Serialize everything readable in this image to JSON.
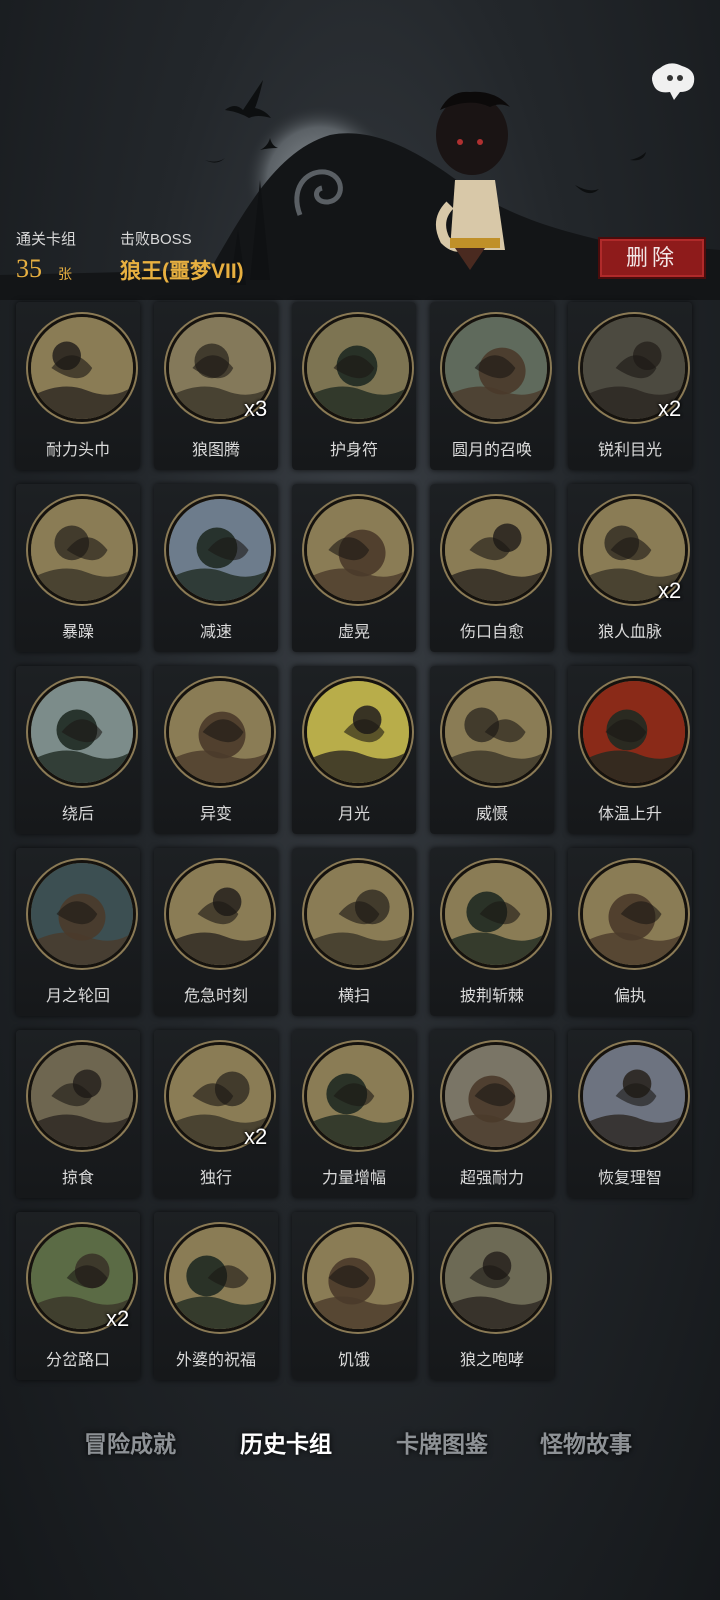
{
  "header": {
    "deck_label": "通关卡组",
    "deck_count": "35",
    "deck_unit": "张",
    "boss_label": "击败BOSS",
    "boss_name": "狼王(噩梦VII)",
    "delete_label": "删除"
  },
  "cards": [
    {
      "name": "耐力头巾",
      "qty": "",
      "icon": "bandana-icon",
      "bg": "#8a7c55"
    },
    {
      "name": "狼图腾",
      "qty": "x3",
      "icon": "wolf-totem-icon",
      "bg": "#84795a"
    },
    {
      "name": "护身符",
      "qty": "",
      "icon": "amulet-icon",
      "bg": "#7d7452"
    },
    {
      "name": "圆月的召唤",
      "qty": "",
      "icon": "full-moon-forest-icon",
      "bg": "#5f6a5c"
    },
    {
      "name": "锐利目光",
      "qty": "x2",
      "icon": "wolf-eyes-icon",
      "bg": "#4c4a40"
    },
    {
      "name": "暴躁",
      "qty": "",
      "icon": "rage-brute-icon",
      "bg": "#8a7c55"
    },
    {
      "name": "减速",
      "qty": "",
      "icon": "clock-slow-icon",
      "bg": "#6d7c8c"
    },
    {
      "name": "虚晃",
      "qty": "",
      "icon": "boxer-icon",
      "bg": "#8a7c55"
    },
    {
      "name": "伤口自愈",
      "qty": "",
      "icon": "healing-boy-icon",
      "bg": "#8a7c55"
    },
    {
      "name": "狼人血脉",
      "qty": "x2",
      "icon": "claw-hand-icon",
      "bg": "#8a7c55"
    },
    {
      "name": "绕后",
      "qty": "",
      "icon": "skull-monster-icon",
      "bg": "#7c8c8a"
    },
    {
      "name": "异变",
      "qty": "",
      "icon": "mutation-icon",
      "bg": "#8a7c55"
    },
    {
      "name": "月光",
      "qty": "",
      "icon": "moonlight-icon",
      "bg": "#b8ad4a"
    },
    {
      "name": "威慑",
      "qty": "",
      "icon": "intimidate-icon",
      "bg": "#8a7c55"
    },
    {
      "name": "体温上升",
      "qty": "",
      "icon": "fire-wolf-icon",
      "bg": "#8a2a18"
    },
    {
      "name": "月之轮回",
      "qty": "",
      "icon": "moon-phases-icon",
      "bg": "#3c4f52"
    },
    {
      "name": "危急时刻",
      "qty": "",
      "icon": "crisis-icon",
      "bg": "#8a7c55"
    },
    {
      "name": "横扫",
      "qty": "",
      "icon": "sweep-icon",
      "bg": "#8a7c55"
    },
    {
      "name": "披荆斩棘",
      "qty": "",
      "icon": "thorns-icon",
      "bg": "#8a7c55"
    },
    {
      "name": "偏执",
      "qty": "",
      "icon": "paranoid-wolf-icon",
      "bg": "#8a7c55"
    },
    {
      "name": "掠食",
      "qty": "",
      "icon": "predator-icon",
      "bg": "#6e6650"
    },
    {
      "name": "独行",
      "qty": "x2",
      "icon": "lone-walker-icon",
      "bg": "#8a7c55"
    },
    {
      "name": "力量增幅",
      "qty": "",
      "icon": "log-lift-icon",
      "bg": "#8a7c55"
    },
    {
      "name": "超强耐力",
      "qty": "",
      "icon": "endurance-icon",
      "bg": "#7a7566"
    },
    {
      "name": "恢复理智",
      "qty": "",
      "icon": "sanity-icon",
      "bg": "#6d7380"
    },
    {
      "name": "分岔路口",
      "qty": "x2",
      "icon": "crossroads-icon",
      "bg": "#5b6b45"
    },
    {
      "name": "外婆的祝福",
      "qty": "",
      "icon": "grandma-icon",
      "bg": "#8a7c55"
    },
    {
      "name": "饥饿",
      "qty": "",
      "icon": "hunger-icon",
      "bg": "#8a7c55"
    },
    {
      "name": "狼之咆哮",
      "qty": "",
      "icon": "wolf-howl-icon",
      "bg": "#6d6a55"
    }
  ],
  "tabs": [
    {
      "label": "冒险成就",
      "active": false
    },
    {
      "label": "历史卡组",
      "active": true
    },
    {
      "label": "卡牌图鉴",
      "active": false
    },
    {
      "label": "怪物故事",
      "active": false
    }
  ]
}
